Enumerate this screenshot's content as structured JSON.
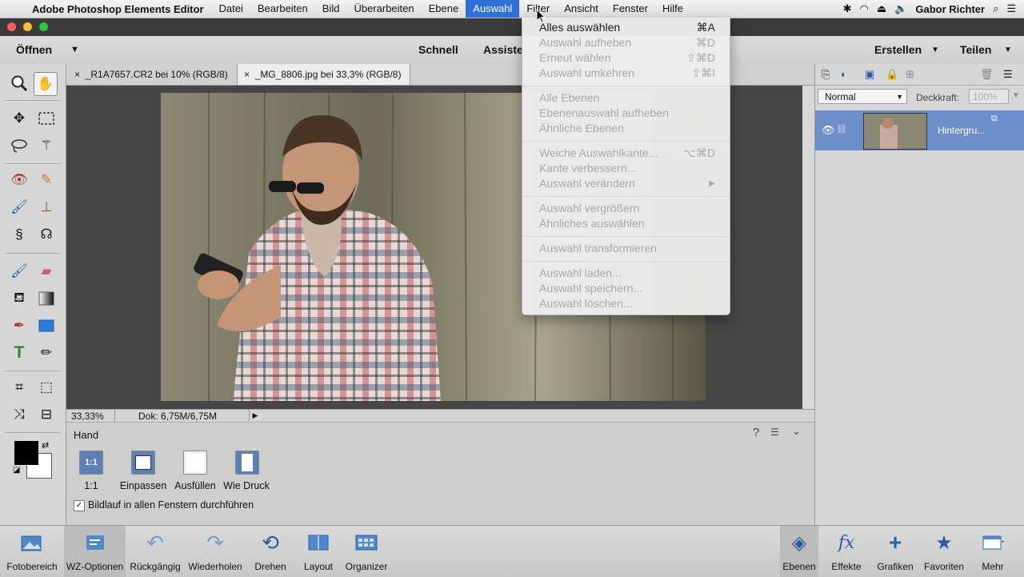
{
  "menubar": {
    "app_name": "Adobe Photoshop Elements Editor",
    "items": [
      "Datei",
      "Bearbeiten",
      "Bild",
      "Überarbeiten",
      "Ebene",
      "Auswahl",
      "Filter",
      "Ansicht",
      "Fenster",
      "Hilfe"
    ],
    "active_item": "Auswahl",
    "user": "Gabor Richter"
  },
  "toolbar": {
    "open_label": "Öffnen",
    "mode_quick": "Schnell",
    "mode_assist": "Assiste",
    "create_label": "Erstellen",
    "share_label": "Teilen"
  },
  "tabs": [
    {
      "label": "_R1A7657.CR2 bei 10% (RGB/8)",
      "active": false
    },
    {
      "label": "_MG_8806.jpg bei 33,3% (RGB/8)",
      "active": true
    }
  ],
  "status": {
    "zoom": "33,33%",
    "doc": "Dok: 6,75M/6,75M"
  },
  "tool_options": {
    "tool_name": "Hand",
    "buttons": [
      {
        "icon_text": "1:1",
        "label": "1:1"
      },
      {
        "label": "Einpassen"
      },
      {
        "label": "Ausfüllen"
      },
      {
        "label": "Wie Druck"
      }
    ],
    "checkbox_label": "Bildlauf in allen Fenstern durchführen",
    "checkbox_checked": true
  },
  "layers": {
    "blend_mode": "Normal",
    "opacity_label": "Deckkraft:",
    "opacity_value": "100%",
    "layer_name": "Hintergru..."
  },
  "bottombar": {
    "left": [
      "Fotobereich",
      "WZ-Optionen",
      "Rückgängig",
      "Wiederholen",
      "Drehen",
      "Layout",
      "Organizer"
    ],
    "right": [
      "Ebenen",
      "Effekte",
      "Grafiken",
      "Favoriten",
      "Mehr"
    ]
  },
  "dropdown": {
    "items": [
      {
        "label": "Alles auswählen",
        "shortcut": "⌘A",
        "enabled": true
      },
      {
        "label": "Auswahl aufheben",
        "shortcut": "⌘D",
        "enabled": false
      },
      {
        "label": "Erneut wählen",
        "shortcut": "⇧⌘D",
        "enabled": false
      },
      {
        "label": "Auswahl umkehren",
        "shortcut": "⇧⌘I",
        "enabled": false
      },
      {
        "label": "Alle Ebenen",
        "shortcut": "",
        "enabled": false
      },
      {
        "label": "Ebenenauswahl aufheben",
        "shortcut": "",
        "enabled": false
      },
      {
        "label": "Ähnliche Ebenen",
        "shortcut": "",
        "enabled": false
      },
      {
        "label": "Weiche Auswahlkante...",
        "shortcut": "⌥⌘D",
        "enabled": false
      },
      {
        "label": "Kante verbessern...",
        "shortcut": "",
        "enabled": false
      },
      {
        "label": "Auswahl verändern",
        "shortcut": "▶",
        "enabled": false
      },
      {
        "label": "Auswahl vergrößern",
        "shortcut": "",
        "enabled": false
      },
      {
        "label": "Ähnliches auswählen",
        "shortcut": "",
        "enabled": false
      },
      {
        "label": "Auswahl transformieren",
        "shortcut": "",
        "enabled": false
      },
      {
        "label": "Auswahl laden...",
        "shortcut": "",
        "enabled": false
      },
      {
        "label": "Auswahl speichern...",
        "shortcut": "",
        "enabled": false
      },
      {
        "label": "Auswahl löschen...",
        "shortcut": "",
        "enabled": false
      }
    ]
  },
  "colors": {
    "accent": "#2f6fd8",
    "layer_selected": "#6d8fc9"
  }
}
